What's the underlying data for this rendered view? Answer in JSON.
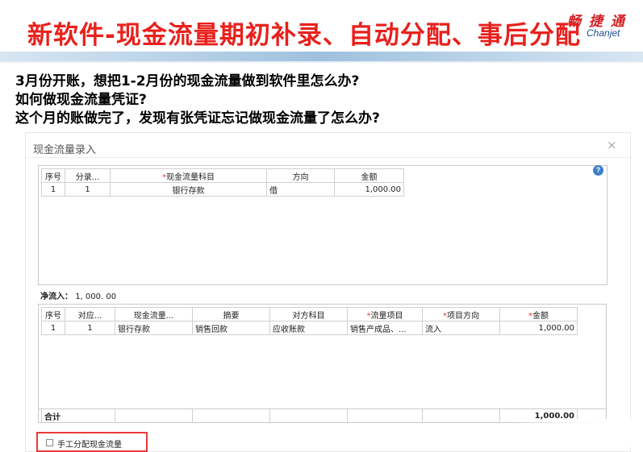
{
  "slide": {
    "title": "新软件-现金流量期初补录、自动分配、事后分配",
    "logo_cn": "畅 捷 通",
    "logo_en": "Chanjet"
  },
  "questions": [
    "3月份开账，想把1-2月份的现金流量做到软件里怎么办?",
    "如何做现金流量凭证?",
    "这个月的账做完了，发现有张凭证忘记做现金流量了怎么办?"
  ],
  "dialog": {
    "title": "现金流量录入",
    "close_icon": "close-icon",
    "help_icon": "help-icon",
    "upper": {
      "headers": [
        "序号",
        "分录...",
        "现金流量科目",
        "方向",
        "金额"
      ],
      "required": [
        false,
        false,
        true,
        false,
        false
      ],
      "rows": [
        [
          "1",
          "1",
          "银行存款",
          "借",
          "1,000.00"
        ]
      ]
    },
    "net": {
      "label": "净流入：",
      "value": "1, 000. 00"
    },
    "lower": {
      "headers": [
        "序号",
        "对应...",
        "现金流量...",
        "摘要",
        "对方科目",
        "流量项目",
        "项目方向",
        "金额"
      ],
      "required": [
        false,
        false,
        false,
        false,
        false,
        true,
        true,
        true
      ],
      "rows": [
        [
          "1",
          "1",
          "银行存款",
          "销售回款",
          "应收账款",
          "销售产成品、...",
          "流入",
          "1,000.00"
        ]
      ],
      "total_label": "合计",
      "total_value": "1,000.00"
    },
    "manual_checkbox_label": "手工分配现金流量"
  },
  "colors": {
    "title_red": "#e8211d",
    "logo_red": "#d41f24",
    "logo_blue": "#1d4f8f",
    "required_star": "#e23b3b",
    "highlight_border": "#e83a3a"
  }
}
